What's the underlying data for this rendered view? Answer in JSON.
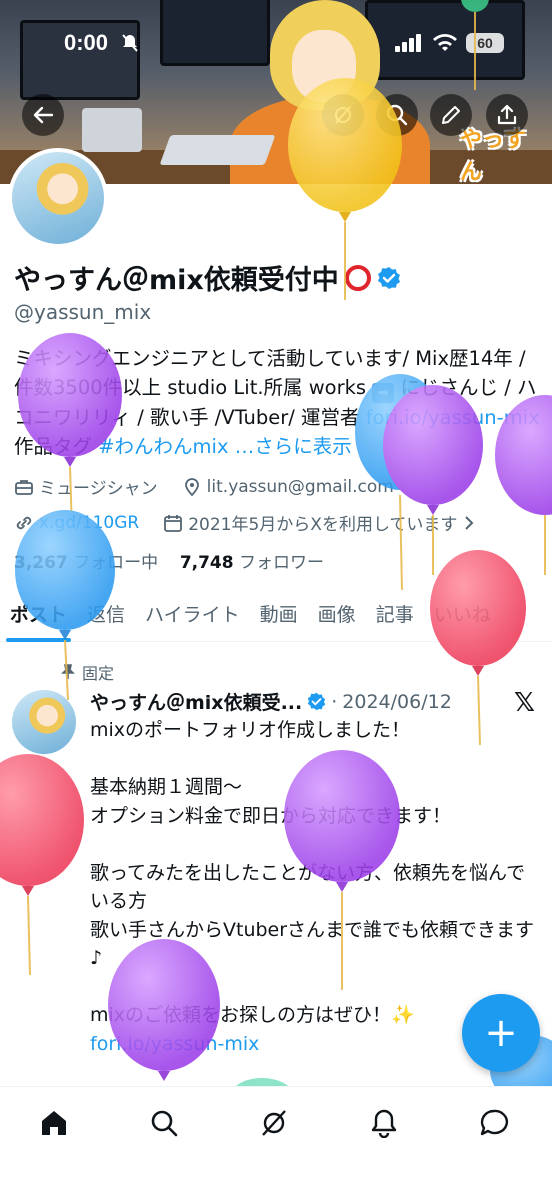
{
  "status_bar": {
    "time": "0:00",
    "battery": "60"
  },
  "profile": {
    "name": "やっすん＠mix依頼受付中",
    "handle": "@yassun_mix",
    "bio_text_1": "ミキシングエンジニアとして活動しています/ Mix歴14年 / 件数3500件以上 studio Lit.所属 works",
    "bio_text_2": " にじさんじ / ハコニワリリィ / 歌い手 /VTuber/ 運営者 ",
    "bio_link": "fori.io/yassun-mix",
    "bio_text_3": " 作品タグ ",
    "bio_hashtag": "#わんわんmix",
    "bio_more": "…さらに表示",
    "category": "ミュージシャン",
    "email": "lit.yassun@gmail.com",
    "website": "x.gd/110GR",
    "joined": "2021年5月からXを利用しています",
    "following_count": "3,267",
    "following_label": "フォロー中",
    "followers_count": "7,748",
    "followers_label": "フォロワー"
  },
  "tabs": [
    "ポスト",
    "返信",
    "ハイライト",
    "動画",
    "画像",
    "記事",
    "いいね"
  ],
  "active_tab": "ポスト",
  "pinned_post": {
    "pinned_label": "固定",
    "author": "やっすん＠mix依頼受...",
    "separator": "·",
    "date": "2024/06/12",
    "lines": [
      "mixのポートフォリオ作成しました！",
      "",
      "基本納期１週間〜",
      "オプション料金で即日から対応できます！",
      "",
      "歌ってみたを出したことがない方、依頼先を悩んでいる方",
      "歌い手さんからVtuberさんまで誰でも依頼できます♪",
      "",
      "mixのご依頼をお探しの方はぜひ！✨"
    ],
    "link": "fori.io/yassun-mix"
  },
  "fab_label": "+",
  "banner_logo": "やっすん",
  "icons": {
    "back": "back-arrow-icon",
    "grok": "grok-icon",
    "search": "search-icon",
    "edit": "edit-pencil-icon",
    "share": "share-icon",
    "category": "briefcase-icon",
    "location": "location-pin-icon",
    "website": "link-icon",
    "calendar": "calendar-icon",
    "verified": "verified-badge-icon",
    "pin": "pin-icon",
    "x": "x-logo-icon",
    "home": "home-icon",
    "explore": "search-icon",
    "grok_nav": "grok-icon",
    "notifications": "bell-icon",
    "messages": "message-icon"
  },
  "colors": {
    "accent": "#1d9bf0",
    "text": "#0f1419",
    "muted": "#536471",
    "ring_emoji": "#e0242b"
  }
}
